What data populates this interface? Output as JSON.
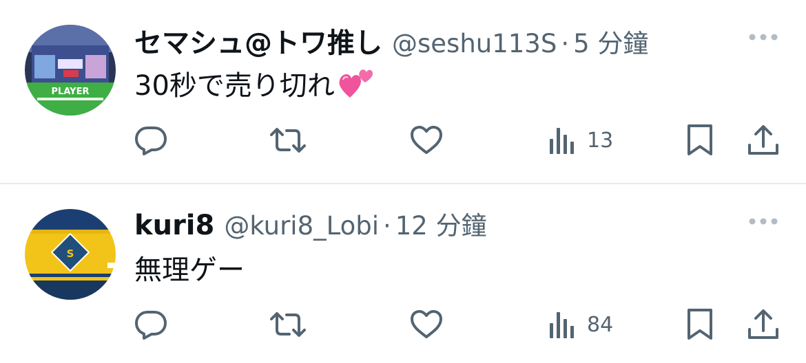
{
  "tweets": [
    {
      "display_name": "セマシュ@トワ推し",
      "handle": "@seshu113S",
      "separator": "·",
      "time": "5 分鐘",
      "text": "30秒で売り切れ",
      "emoji": "two-hearts-emoji",
      "avatar_badge_text": "PLAYER",
      "views": "13"
    },
    {
      "display_name": "kuri8",
      "handle": "@kuri8_Lobi",
      "separator": "·",
      "time": "12 分鐘",
      "text": "無理ゲー",
      "views": "84"
    }
  ],
  "colors": {
    "primary_text": "#0f1419",
    "secondary_text": "#536471",
    "divider": "#e7e9eb",
    "more_dots": "#b3bcc4"
  },
  "icons": {
    "reply": "reply-icon",
    "retweet": "retweet-icon",
    "like": "like-icon",
    "views": "views-icon",
    "bookmark": "bookmark-icon",
    "share": "share-icon",
    "more": "more-icon"
  }
}
